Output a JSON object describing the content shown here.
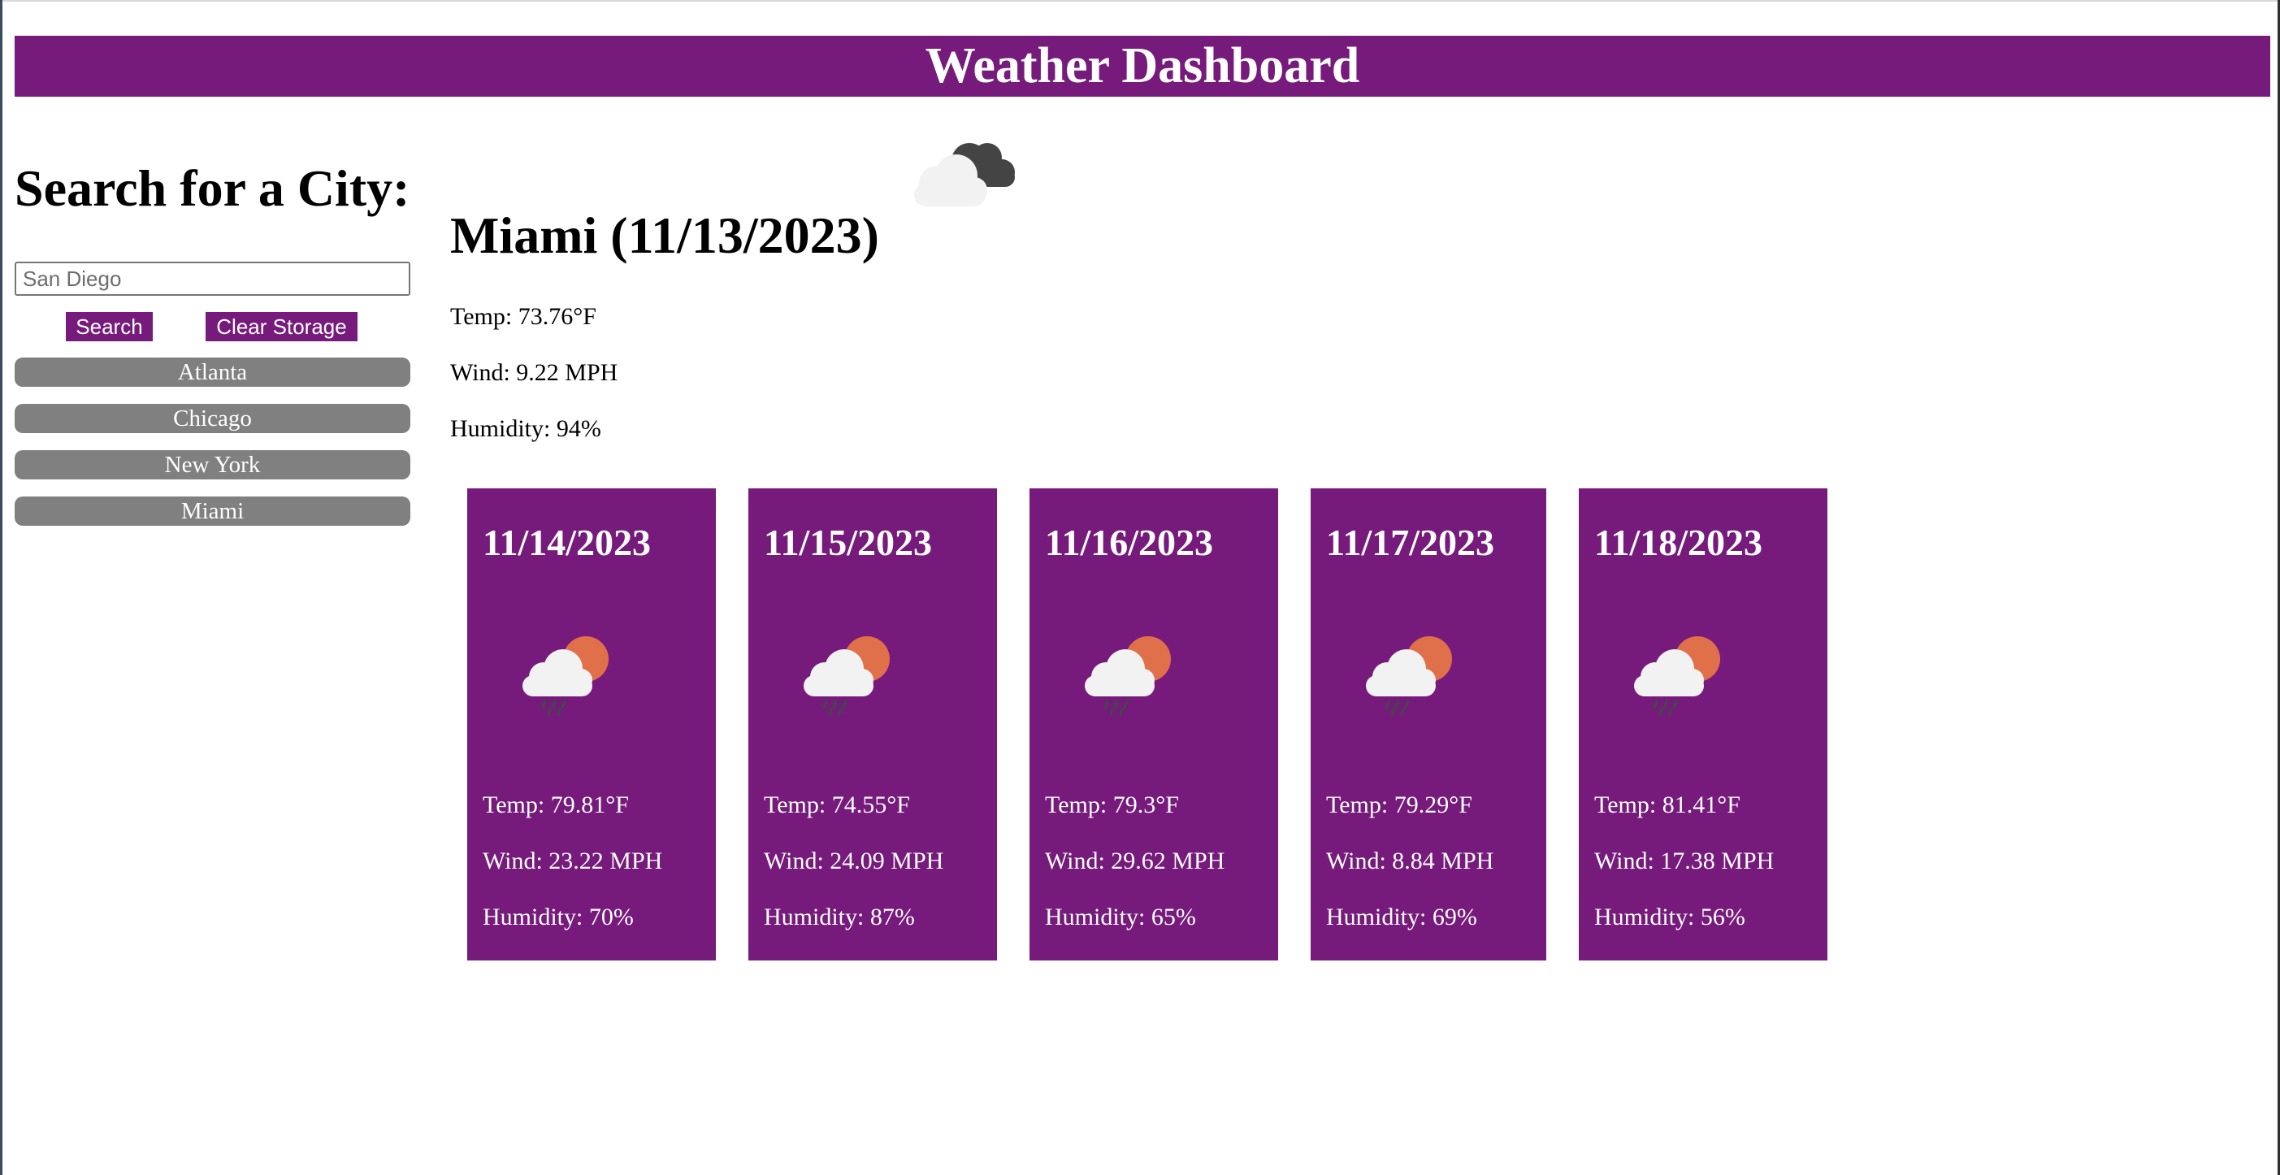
{
  "header": {
    "title": "Weather Dashboard"
  },
  "sidebar": {
    "heading": "Search for a City:",
    "search": {
      "value": "",
      "placeholder": "San Diego"
    },
    "search_button": "Search",
    "clear_button": "Clear Storage",
    "history": [
      "Atlanta",
      "Chicago",
      "New York",
      "Miami"
    ]
  },
  "current": {
    "title": "Miami (11/13/2023)",
    "icon": "broken-clouds-icon",
    "temp": "Temp: 73.76°F",
    "wind": "Wind: 9.22 MPH",
    "humidity": "Humidity: 94%"
  },
  "forecast": [
    {
      "date": "11/14/2023",
      "icon": "rain-sun-icon",
      "temp": "Temp: 79.81°F",
      "wind": "Wind: 23.22 MPH",
      "humidity": "Humidity: 70%"
    },
    {
      "date": "11/15/2023",
      "icon": "rain-sun-icon",
      "temp": "Temp: 74.55°F",
      "wind": "Wind: 24.09 MPH",
      "humidity": "Humidity: 87%"
    },
    {
      "date": "11/16/2023",
      "icon": "rain-sun-icon",
      "temp": "Temp: 79.3°F",
      "wind": "Wind: 29.62 MPH",
      "humidity": "Humidity: 65%"
    },
    {
      "date": "11/17/2023",
      "icon": "rain-sun-icon",
      "temp": "Temp: 79.29°F",
      "wind": "Wind: 8.84 MPH",
      "humidity": "Humidity: 69%"
    },
    {
      "date": "11/18/2023",
      "icon": "rain-sun-icon",
      "temp": "Temp: 81.41°F",
      "wind": "Wind: 17.38 MPH",
      "humidity": "Humidity: 56%"
    }
  ],
  "colors": {
    "accent": "#761b7c",
    "history_button": "#808080",
    "sun": "#e0704a",
    "cloud": "#f2f2f2",
    "dark_cloud": "#444444"
  }
}
